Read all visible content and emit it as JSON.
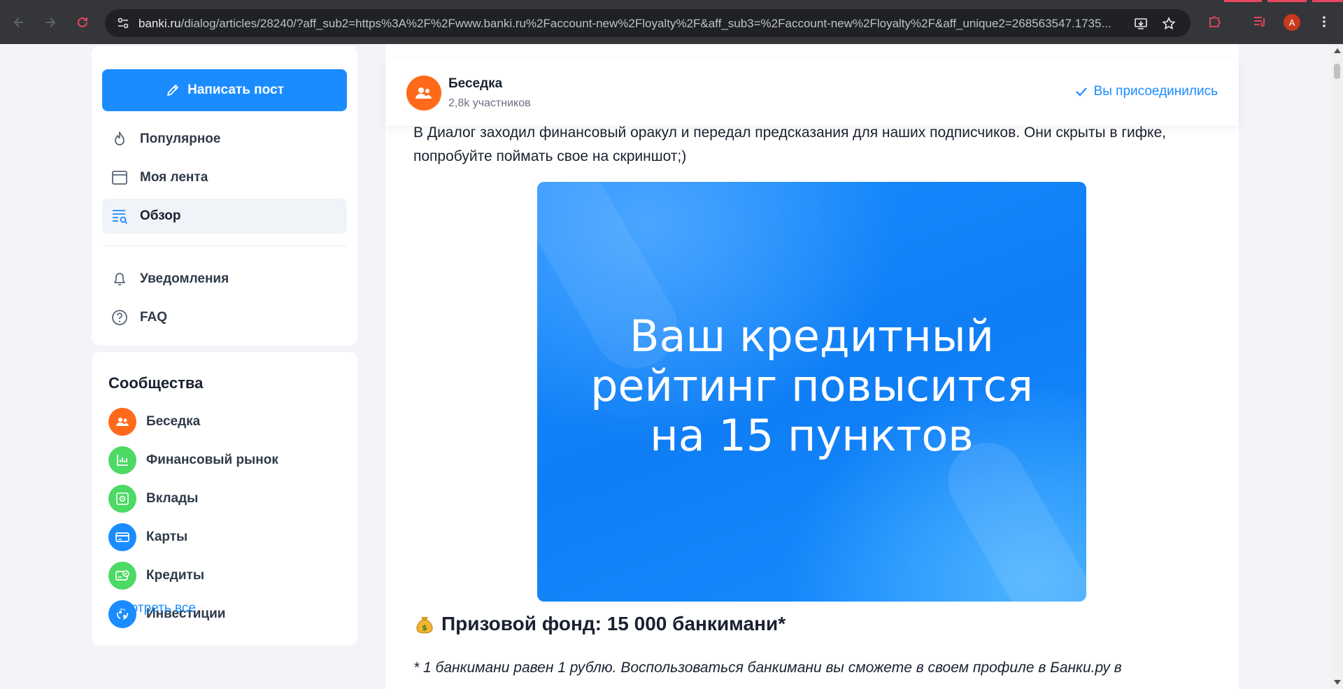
{
  "browser": {
    "url_host": "banki.ru",
    "url_rest": "/dialog/articles/28240/?aff_sub2=https%3A%2F%2Fwww.banki.ru%2Faccount-new%2Floyalty%2F&aff_sub3=%2Faccount-new%2Floyalty%2F&aff_unique2=268563547.1735...",
    "avatar_letter": "A"
  },
  "sidebar": {
    "write_post": "Написать пост",
    "menu": [
      {
        "label": "Популярное",
        "icon": "flame-icon"
      },
      {
        "label": "Моя лента",
        "icon": "feed-icon"
      },
      {
        "label": "Обзор",
        "icon": "overview-icon",
        "active": true
      },
      {
        "label": "Уведомления",
        "icon": "bell-icon"
      },
      {
        "label": "FAQ",
        "icon": "help-icon"
      }
    ]
  },
  "communities": {
    "title": "Сообщества",
    "items": [
      {
        "label": "Беседка",
        "color": "#ff6a1a",
        "icon": "people-icon"
      },
      {
        "label": "Финансовый рынок",
        "color": "#4cd964",
        "icon": "chart-icon"
      },
      {
        "label": "Вклады",
        "color": "#4cd964",
        "icon": "safe-icon"
      },
      {
        "label": "Карты",
        "color": "#1a8cff",
        "icon": "card-icon"
      },
      {
        "label": "Кредиты",
        "color": "#4cd964",
        "icon": "credit-icon"
      },
      {
        "label": "Инвестиции",
        "color": "#1a8cff",
        "icon": "invest-icon"
      }
    ],
    "see_all": "Смотреть все"
  },
  "group": {
    "name": "Беседка",
    "members": "2,8k участников",
    "joined": "Вы присоединились"
  },
  "article": {
    "intro": "В Диалог заходил финансовый оракул и передал предсказания для наших подписчиков. Они скрыты в гифке, попробуйте поймать свое на скриншот;)",
    "promo_line1": "Ваш кредитный",
    "promo_line2": "рейтинг повысится",
    "promo_line3": "на 15 пунктов",
    "prize": "Призовой фонд: 15 000 банкимани*",
    "note": "* 1 банкимани равен 1 рублю. Воспользоваться банкимани вы сможете в своем профиле в Банки.ру в"
  },
  "colors": {
    "accent": "#1a8cff",
    "orange": "#ff6a1a",
    "green": "#4cd964"
  }
}
